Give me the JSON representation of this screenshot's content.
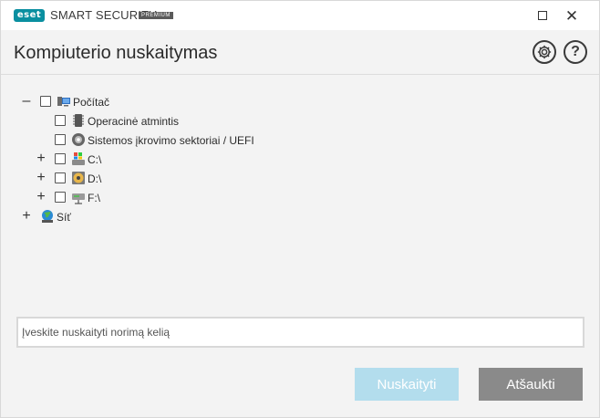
{
  "titlebar": {
    "logo_text": "eset",
    "product_name": "SMART SECURITY",
    "edition": "PREMIUM",
    "maximize_icon": "maximize-icon",
    "close_symbol": "✕"
  },
  "header": {
    "title": "Kompiuterio nuskaitymas",
    "settings_icon": "gear-icon",
    "help_symbol": "?"
  },
  "tree": {
    "computer": {
      "label": "Počítač",
      "expander": "–",
      "icon": "computer-icon"
    },
    "memory": {
      "label": "Operacinė atmintis",
      "icon": "memory-chip-icon"
    },
    "boot": {
      "label": "Sistemos įkrovimo sektoriai / UEFI",
      "icon": "disc-icon"
    },
    "drive_c": {
      "label": "C:\\",
      "expander": "+",
      "icon": "windows-drive-icon"
    },
    "drive_d": {
      "label": "D:\\",
      "expander": "+",
      "icon": "optical-drive-icon"
    },
    "drive_f": {
      "label": "F:\\",
      "expander": "+",
      "icon": "removable-drive-icon"
    },
    "network": {
      "label": "Síť",
      "expander": "+",
      "icon": "network-globe-icon"
    }
  },
  "path_input": {
    "placeholder": "Įveskite nuskaityti norimą kelią",
    "value": ""
  },
  "buttons": {
    "scan": "Nuskaityti",
    "cancel": "Atšaukti"
  },
  "colors": {
    "brand": "#0a8fa0",
    "scan_button_disabled": "#b3dded",
    "cancel_button": "#8a8a8a",
    "background": "#f3f3f3"
  }
}
